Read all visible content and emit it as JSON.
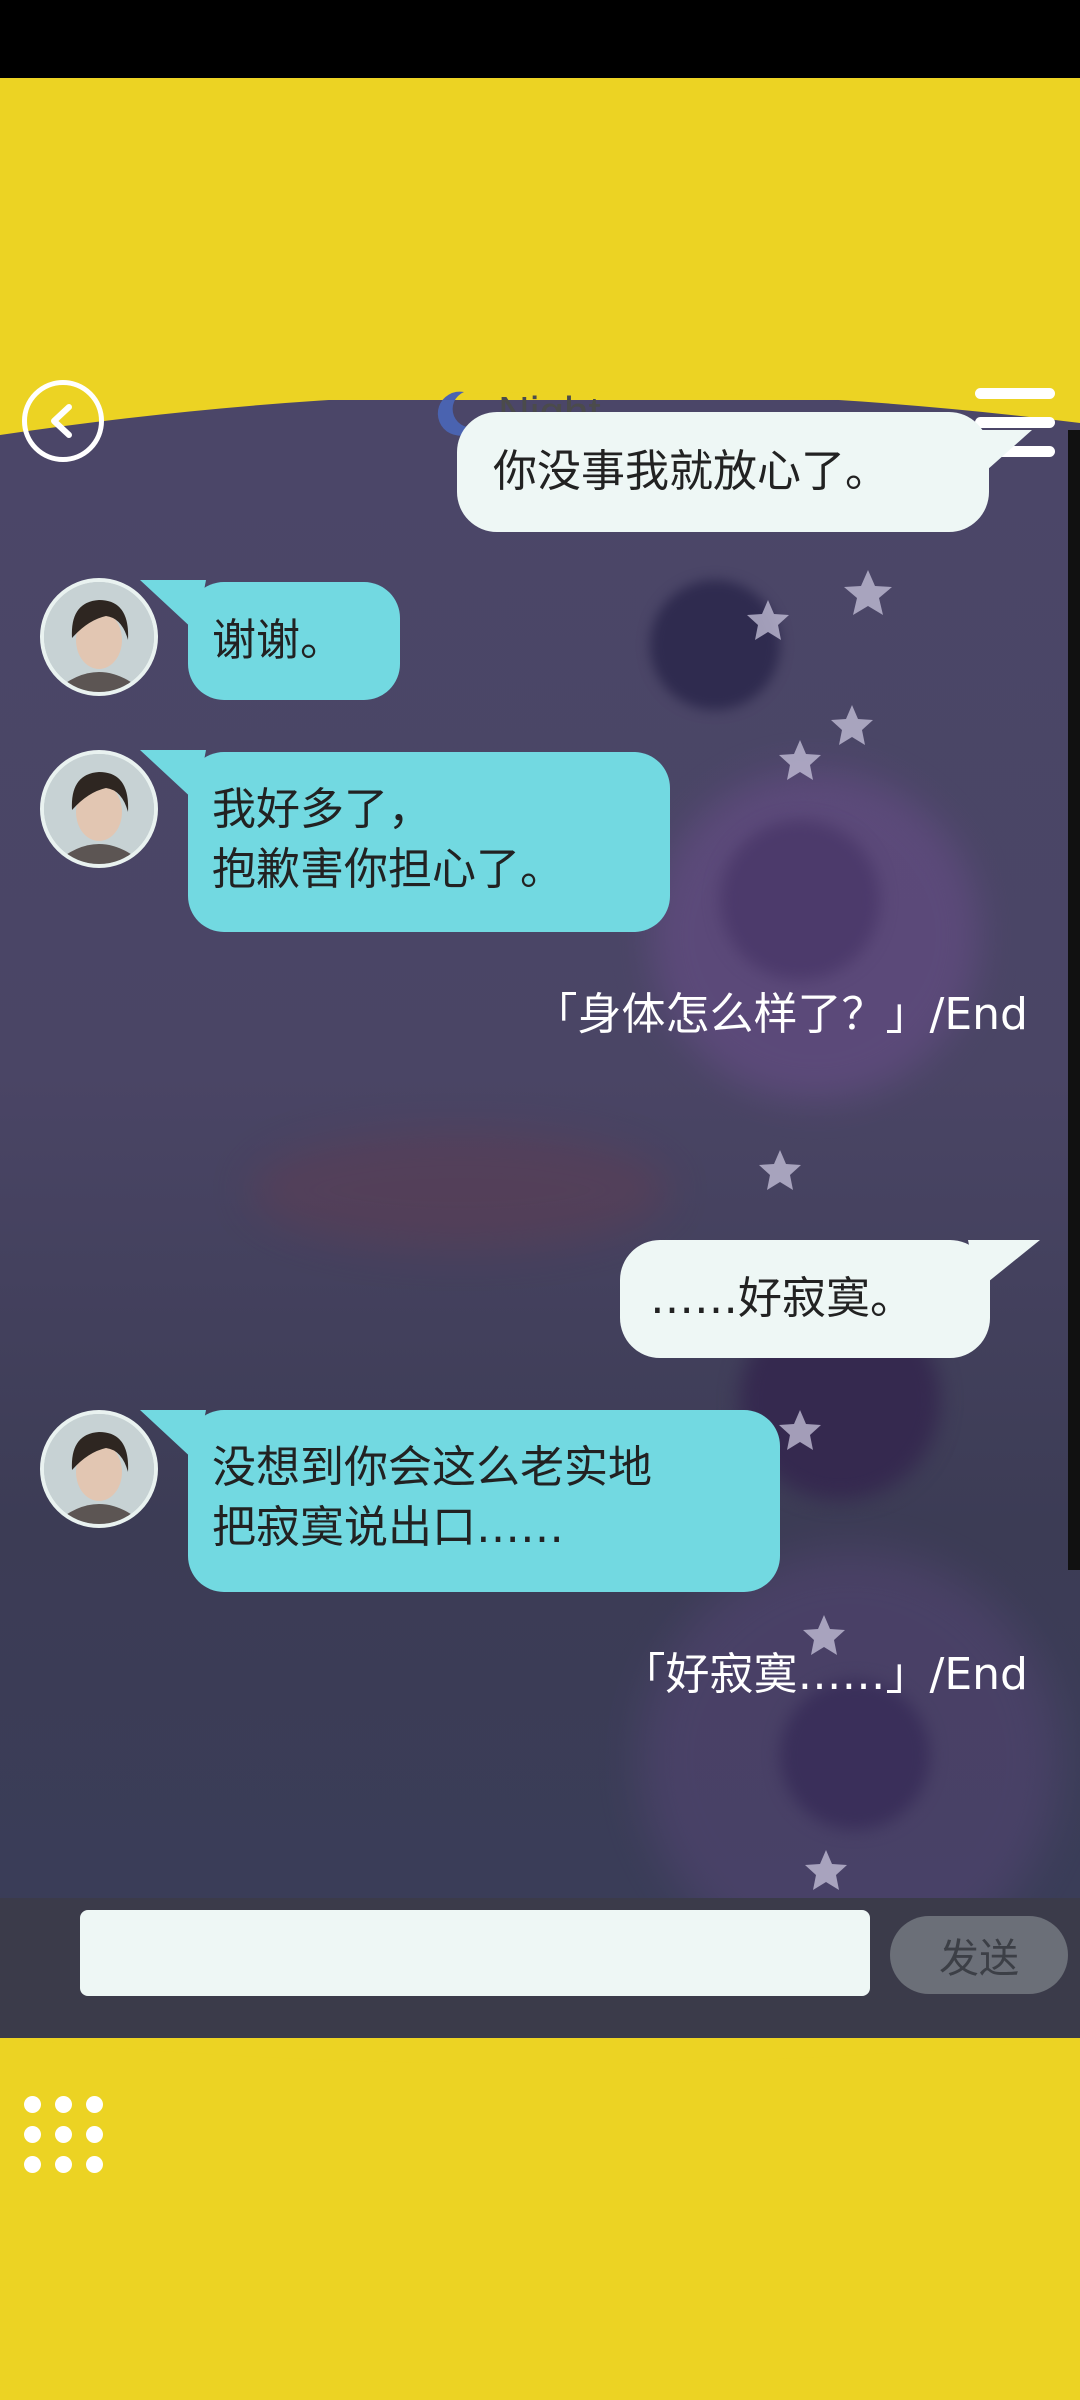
{
  "header": {
    "title": "Night",
    "icons": {
      "back": "back-chevron-icon",
      "moon": "moon-icon",
      "menu": "menu-icon"
    }
  },
  "messages": [
    {
      "side": "right",
      "lines": [
        "你没事我就放心了。"
      ]
    },
    {
      "side": "left",
      "lines": [
        "谢谢。"
      ]
    },
    {
      "side": "left",
      "lines": [
        "我好多了，",
        "抱歉害你担心了。"
      ]
    },
    {
      "side": "right",
      "lines": [
        "……好寂寞。"
      ]
    },
    {
      "side": "left",
      "lines": [
        "没想到你会这么老实地",
        "把寂寞说出口……"
      ]
    }
  ],
  "choices": [
    {
      "text": "「身体怎么样了？」/End"
    },
    {
      "text": "「好寂寞……」/End"
    }
  ],
  "input": {
    "placeholder": "",
    "send_label": "发送"
  },
  "colors": {
    "app_yellow": "#ecd323",
    "left_bubble": "#72d9e1",
    "right_bubble": "#eef7f5",
    "send_button": "#6b6f78"
  }
}
